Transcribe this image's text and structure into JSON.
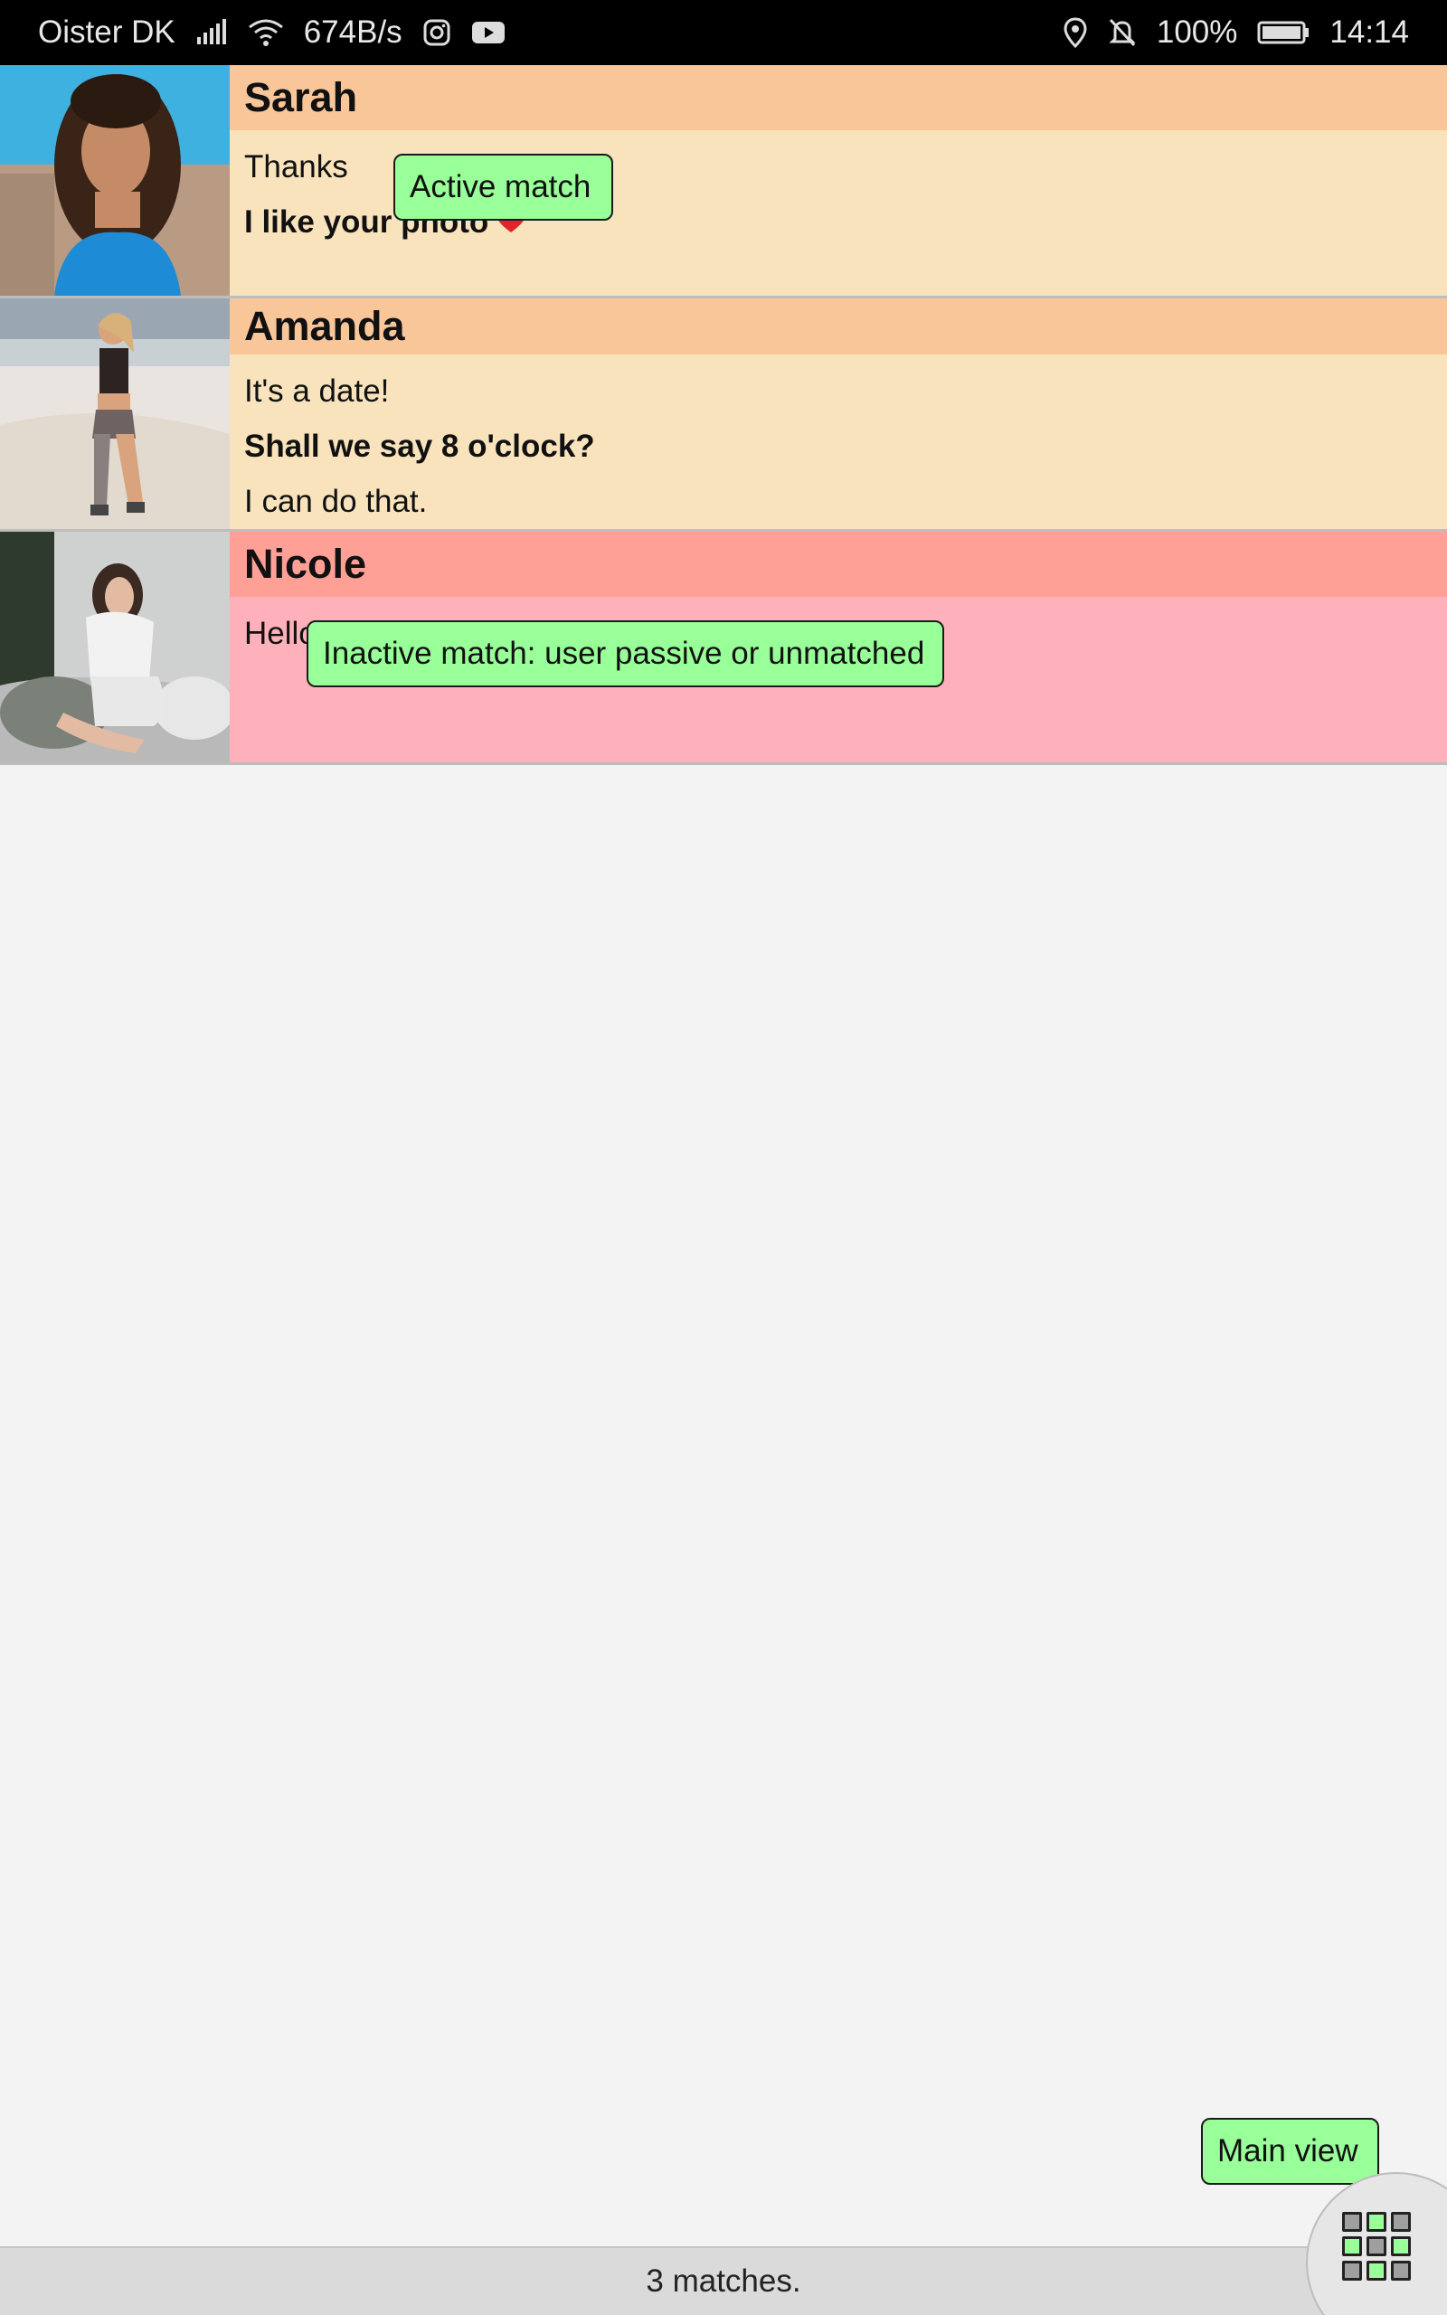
{
  "status_bar": {
    "carrier": "Oister DK",
    "net_speed": "674B/s",
    "battery": "100%",
    "time": "14:14"
  },
  "matches": [
    {
      "name": "Sarah",
      "state": "active",
      "messages": [
        {
          "text": "Thanks",
          "bold": false
        },
        {
          "text": "I like your photo",
          "bold": true
        }
      ]
    },
    {
      "name": "Amanda",
      "state": "active",
      "messages": [
        {
          "text": "It's a date!",
          "bold": false
        },
        {
          "text": "Shall we say 8 o'clock?",
          "bold": true
        },
        {
          "text": "I can do that.",
          "bold": false
        }
      ]
    },
    {
      "name": "Nicole",
      "state": "inactive",
      "messages": [
        {
          "text": "Hello",
          "bold": false
        }
      ]
    }
  ],
  "tooltips": {
    "active": "Active match",
    "inactive": "Inactive match: user passive or unmatched",
    "main_view": "Main view"
  },
  "footer": {
    "count_text": "3 matches."
  },
  "icons": {
    "menu": "grid-menu-icon",
    "heart": "heart-icon"
  }
}
